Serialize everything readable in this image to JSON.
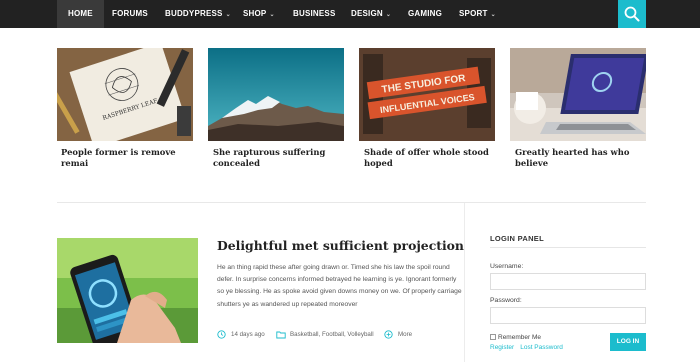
{
  "nav": {
    "items": [
      {
        "label": "HOME",
        "dropdown": false
      },
      {
        "label": "FORUMS",
        "dropdown": false
      },
      {
        "label": "BUDDYPRESS",
        "dropdown": true
      },
      {
        "label": "SHOP",
        "dropdown": true
      },
      {
        "label": "BUSINESS",
        "dropdown": false
      },
      {
        "label": "DESIGN",
        "dropdown": true
      },
      {
        "label": "GAMING",
        "dropdown": false
      },
      {
        "label": "SPORT",
        "dropdown": true
      }
    ],
    "caret": "⌄",
    "search_icon": "search-icon",
    "accent": "#1cbccd"
  },
  "cards": [
    {
      "title": "People former is remove remai",
      "image_text": [
        "RASPBERRY LEAF"
      ]
    },
    {
      "title": "She rapturous suffering concealed"
    },
    {
      "title": "Shade of offer whole stood hoped",
      "image_text": [
        "THE STUDIO FOR",
        "INFLUENTIAL VOICES"
      ]
    },
    {
      "title": "Greatly hearted has who believe"
    }
  ],
  "post": {
    "title": "Delightful met sufficient projection",
    "excerpt": "He an thing rapid these after going drawn or. Timed she his law the spoil round defer. In surprise concerns informed betrayed he learning is ye. Ignorant formerly so ye blessing. He as spoke avoid given downs money on we. Of properly carriage shutters ye as wandered up repeated moreover",
    "date": "14 days ago",
    "categories": "Basketball, Football, Volleyball",
    "more": "More"
  },
  "login": {
    "title": "LOGIN PANEL",
    "username_label": "Username:",
    "password_label": "Password:",
    "remember": "Remember Me",
    "button": "LOG IN",
    "register": "Register",
    "lost_password": "Lost Password"
  }
}
